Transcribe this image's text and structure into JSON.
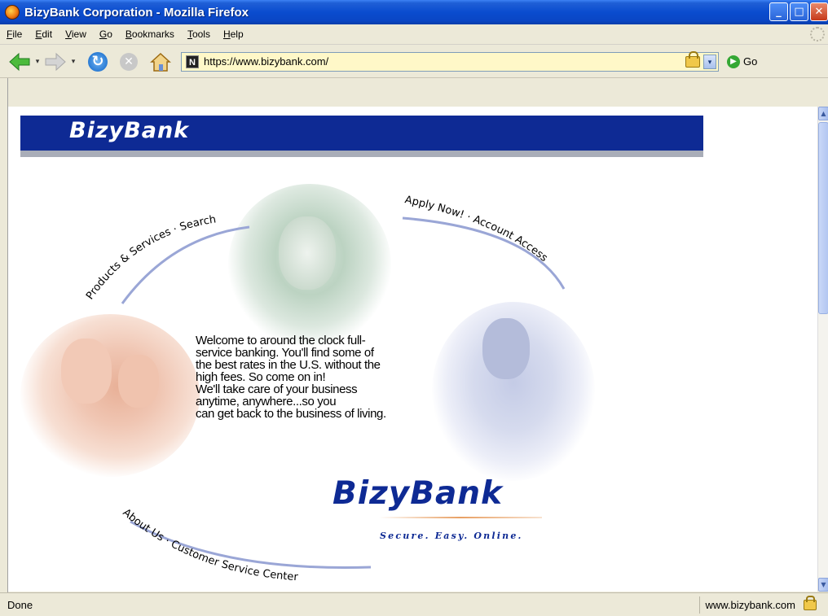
{
  "window": {
    "title": "BizyBank Corporation - Mozilla Firefox",
    "minimize": "_",
    "maximize": "□",
    "close": "✕"
  },
  "menu": [
    {
      "label": "File",
      "accel": "F",
      "rest": "ile"
    },
    {
      "label": "Edit",
      "accel": "E",
      "rest": "dit"
    },
    {
      "label": "View",
      "accel": "V",
      "rest": "iew"
    },
    {
      "label": "Go",
      "accel": "G",
      "rest": "o"
    },
    {
      "label": "Bookmarks",
      "accel": "B",
      "rest": "ookmarks"
    },
    {
      "label": "Tools",
      "accel": "T",
      "rest": "ools"
    },
    {
      "label": "Help",
      "accel": "H",
      "rest": "elp"
    }
  ],
  "toolbar": {
    "url": "https://www.bizybank.com/",
    "site_icon": "N",
    "go_label": "Go"
  },
  "page": {
    "header_logo": "BizyBank",
    "arc_top_left": "Products & Services · Search",
    "arc_top_right": "Apply Now! · Account Access",
    "arc_bottom": "About Us · Customer Service Center",
    "welcome_lines": [
      "Welcome to around the clock full-",
      "service banking. You'll find some of",
      "the best rates in the U.S. without the",
      "high fees. So come on in!",
      "We'll take care of your business",
      "anytime, anywhere...so you",
      "can get back to the business of living."
    ],
    "brand_logo": "BizyBank",
    "tagline": "Secure. Easy. Online."
  },
  "status": {
    "text": "Done",
    "site": "www.bizybank.com"
  },
  "icons": {
    "back": "back-arrow-icon",
    "forward": "forward-arrow-icon",
    "reload": "reload-icon",
    "stop": "stop-icon",
    "home": "home-icon",
    "lock": "lock-icon"
  }
}
